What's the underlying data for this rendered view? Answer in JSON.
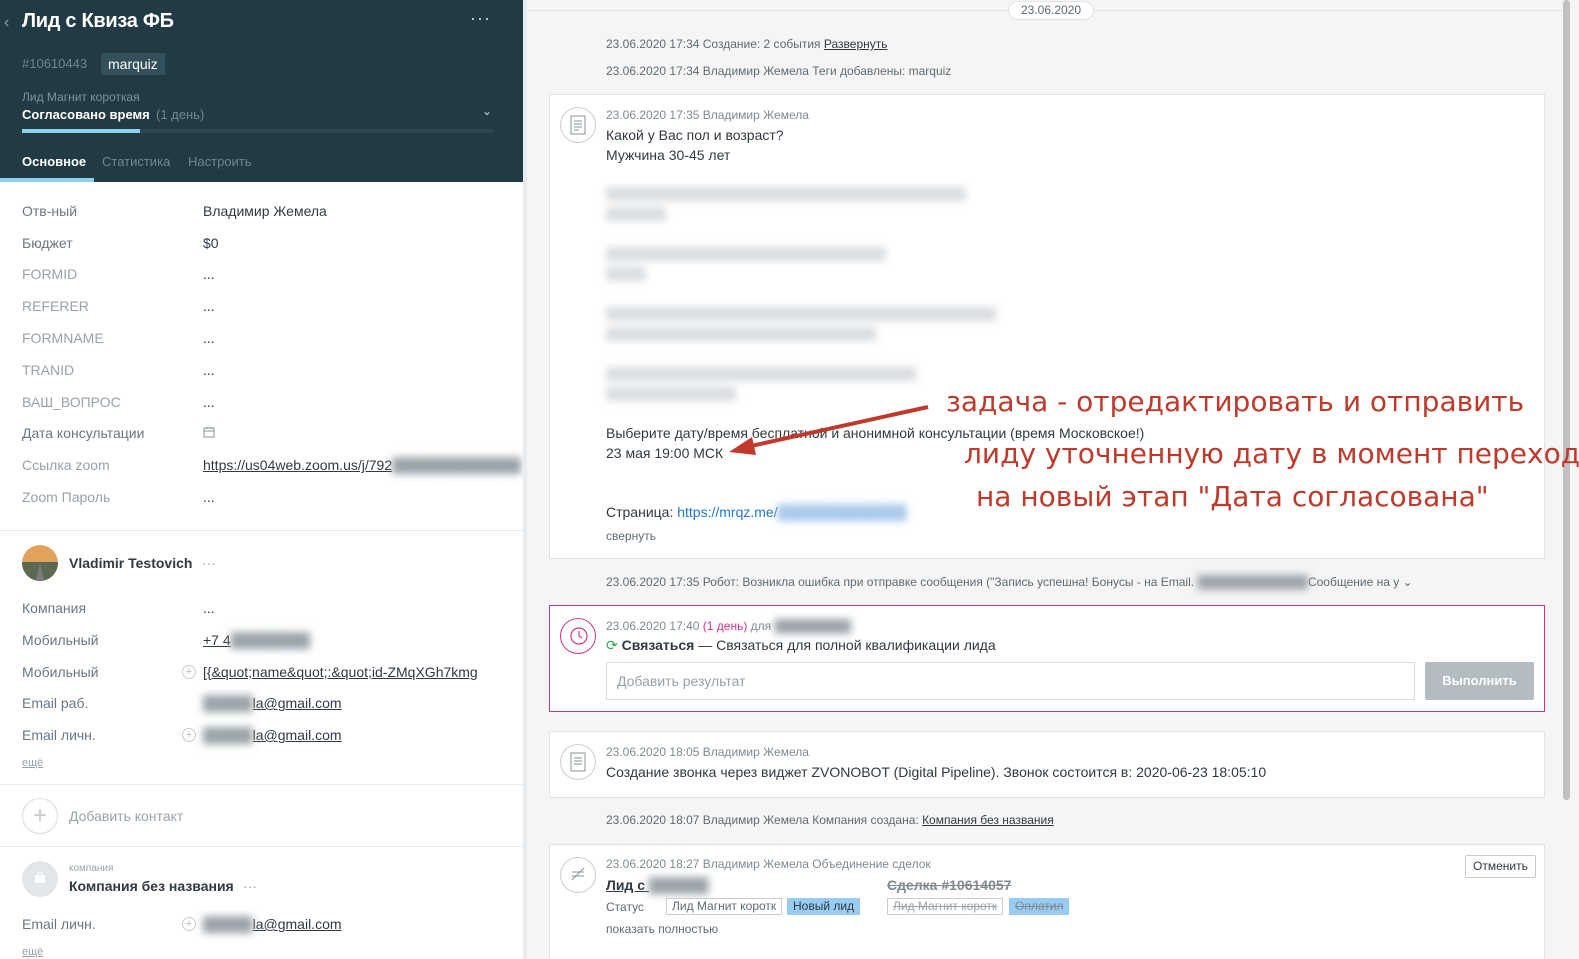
{
  "lead": {
    "title": "Лид с Квиза ФБ",
    "id": "#10610443",
    "tag": "marquiz",
    "pipeline": "Лид Магнит короткая",
    "stage": "Согласовано время",
    "stage_duration": "(1 день)",
    "stage_progress_percent": 25,
    "tabs": [
      "Основное",
      "Статистика",
      "Настроить"
    ]
  },
  "fields": [
    {
      "label": "Отв-ный",
      "value": "Владимир Жемела"
    },
    {
      "label": "Бюджет",
      "value": "$0"
    },
    {
      "label": "FORMID",
      "value": "..."
    },
    {
      "label": "REFERER",
      "value": "..."
    },
    {
      "label": "FORMNAME",
      "value": "..."
    },
    {
      "label": "TRANID",
      "value": "..."
    },
    {
      "label": "ВАШ_ВОПРОС",
      "value": "..."
    },
    {
      "label": "Дата консультации",
      "value": ""
    },
    {
      "label": "Ссылка zoom",
      "value": "https://us04web.zoom.us/j/792"
    },
    {
      "label": "Zoom Пароль",
      "value": "..."
    }
  ],
  "contact": {
    "name": "Vladimir Testovich",
    "dots": "···",
    "fields": [
      {
        "label": "Компания",
        "value": "..."
      },
      {
        "label": "Мобильный",
        "value": "+7 4"
      },
      {
        "label": "Мобильный",
        "value": "[{&quot;name&quot;:&quot;id-ZMqXGh7kmg"
      },
      {
        "label": "Email раб.",
        "value": "la@gmail.com"
      },
      {
        "label": "Email личн.",
        "value": "la@gmail.com"
      }
    ],
    "more": "ещё"
  },
  "add_contact": "Добавить контакт",
  "company": {
    "caption": "компания",
    "name": "Компания без названия",
    "dots": "···",
    "field_label": "Email личн.",
    "field_value": "la@gmail.com",
    "more": "ещё"
  },
  "feed": {
    "date": "23.06.2020",
    "event1": {
      "text": "23.06.2020 17:34 Создание: 2 события",
      "link": "Развернуть"
    },
    "event2": "23.06.2020 17:34 Владимир Жемела  Теги добавлены: marquiz",
    "note": {
      "meta": "23.06.2020 17:35 Владимир Жемела",
      "q1": "Какой у Вас пол и возраст?",
      "a1": "Мужчина 30-45 лет",
      "q_date": "Выберите дату/время бесплатной и анонимной консультации (время Московское!)",
      "a_date": "23 мая 19:00 МСК",
      "page_label": "Страница:",
      "page_link": "https://mrqz.me/",
      "collapse": "свернуть"
    },
    "robot": "23.06.2020 17:35 Робот: Возникла ошибка при отправке сообщения (\"Запись успешна! Бонусы - на Email.",
    "robot_tail": "Сообщение на у",
    "task": {
      "meta_date": "23.06.2020 17:40",
      "meta_dur": "(1 день)",
      "meta_for": "для",
      "type": "Связаться",
      "text": " — Связаться для полной квалификации лида",
      "input_placeholder": "Добавить результат",
      "button": "Выполнить"
    },
    "call": {
      "meta": "23.06.2020 18:05 Владимир Жемела",
      "text": "Создание звонка через виджет ZVONOBOT (Digital Pipeline). Звонок состоится в: 2020-06-23 18:05:10"
    },
    "company_event": {
      "text": "23.06.2020 18:07 Владимир Жемела  Компания создана:",
      "link": "Компания без названия"
    },
    "merge": {
      "meta": "23.06.2020 18:27 Владимир Жемела  Объединение сделок",
      "cancel": "Отменить",
      "lead_a": "Лид с",
      "lead_b": "Сделка #10614057",
      "status_label": "Статус",
      "a_pipeline": "Лид Магнит коротк",
      "a_stage": "Новый лид",
      "b_pipeline": "Лид Магнит коротк",
      "b_stage": "Оплатил",
      "show_full": "показать полностью"
    }
  },
  "annotation": {
    "line1": "задача - отредактировать и отправить",
    "line2": "лиду уточненную дату в момент перехода",
    "line3": "на новый этап \"Дата согласована\"",
    "color": "#c0392b"
  }
}
